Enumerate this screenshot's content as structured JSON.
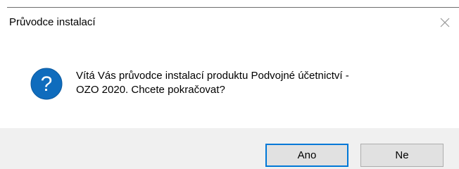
{
  "window": {
    "title": "Průvodce instalací",
    "close_icon": "close-icon"
  },
  "message": {
    "icon": "question-icon",
    "text": "Vítá Vás průvodce instalací produktu Podvojné účetnictví -\nOZO 2020. Chcete pokračovat?"
  },
  "buttons": {
    "yes_label": "Ano",
    "no_label": "Ne"
  },
  "colors": {
    "icon_blue": "#0f6cbd",
    "focus_border": "#0078d7",
    "footer_background": "#f0f0f0",
    "button_face": "#e1e1e1"
  }
}
